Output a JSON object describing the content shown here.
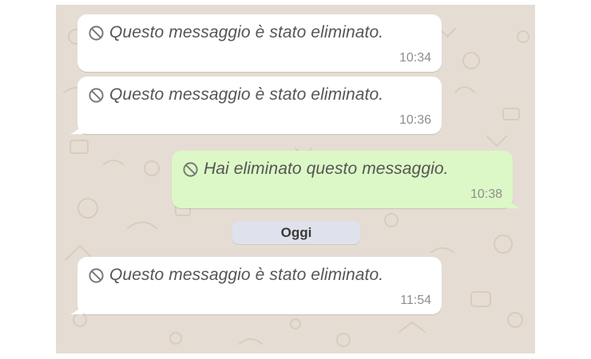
{
  "chat": {
    "messages": [
      {
        "direction": "incoming",
        "text": "Questo messaggio è stato eliminato.",
        "time": "10:34",
        "icon": "deleted-message-icon"
      },
      {
        "direction": "incoming",
        "text": "Questo messaggio è stato eliminato.",
        "time": "10:36",
        "icon": "deleted-message-icon"
      },
      {
        "direction": "outgoing",
        "text": "Hai eliminato questo messaggio.",
        "time": "10:38",
        "icon": "deleted-message-icon"
      },
      {
        "direction": "incoming",
        "text": "Questo messaggio è stato eliminato.",
        "time": "11:54",
        "icon": "deleted-message-icon"
      }
    ],
    "date_separator": "Oggi"
  },
  "colors": {
    "wallpaper": "#e5ddd3",
    "incoming_bubble": "#ffffff",
    "outgoing_bubble": "#dcf8c6",
    "date_pill": "#dfe2ec"
  }
}
